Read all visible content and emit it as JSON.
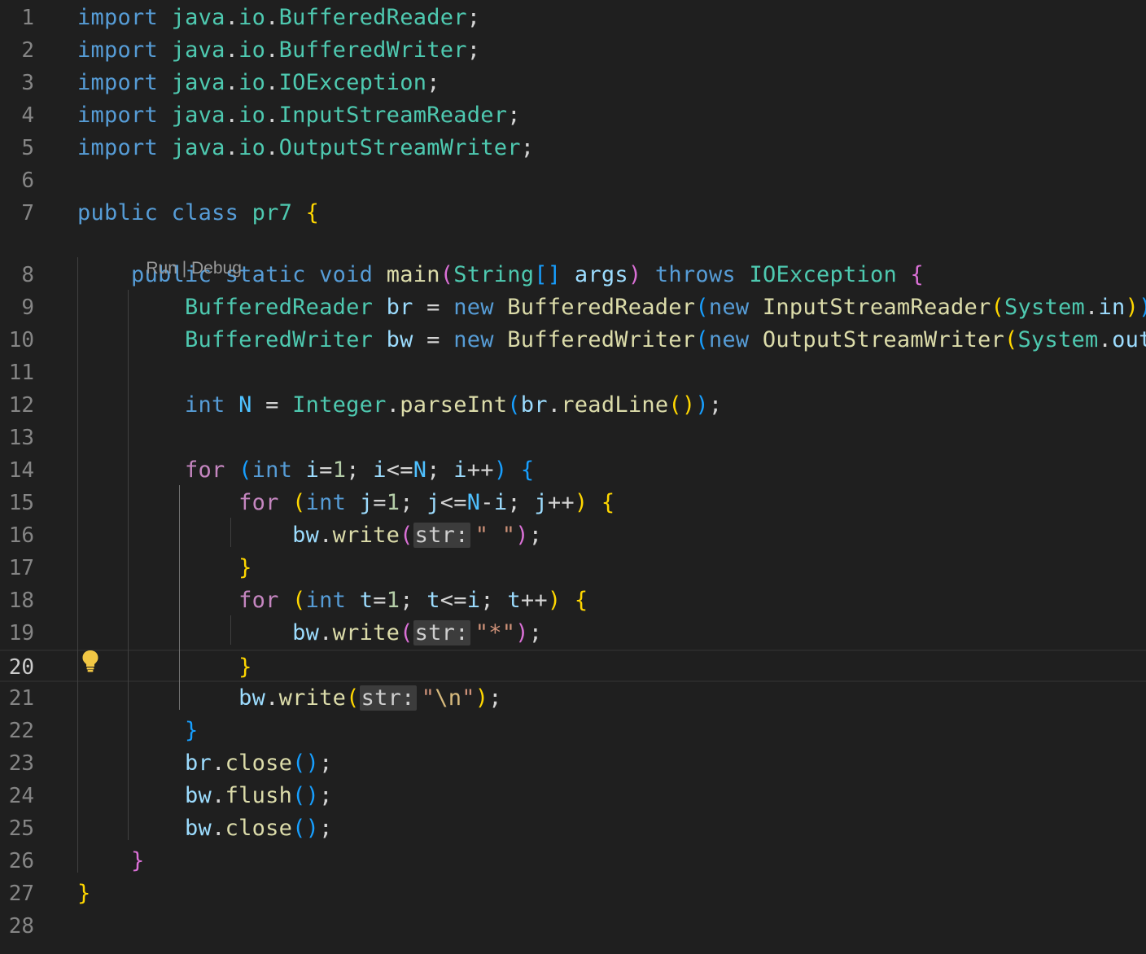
{
  "editor": {
    "code_lens": {
      "run": "Run",
      "separator": " | ",
      "debug": "Debug"
    },
    "current_line": 20,
    "lines": [
      {
        "n": "1",
        "tokens": [
          [
            "kw",
            "import"
          ],
          [
            "pun",
            " "
          ],
          [
            "pkg",
            "java"
          ],
          [
            "pun",
            "."
          ],
          [
            "pkg",
            "io"
          ],
          [
            "pun",
            "."
          ],
          [
            "typ",
            "BufferedReader"
          ],
          [
            "pun",
            ";"
          ]
        ]
      },
      {
        "n": "2",
        "tokens": [
          [
            "kw",
            "import"
          ],
          [
            "pun",
            " "
          ],
          [
            "pkg",
            "java"
          ],
          [
            "pun",
            "."
          ],
          [
            "pkg",
            "io"
          ],
          [
            "pun",
            "."
          ],
          [
            "typ",
            "BufferedWriter"
          ],
          [
            "pun",
            ";"
          ]
        ]
      },
      {
        "n": "3",
        "tokens": [
          [
            "kw",
            "import"
          ],
          [
            "pun",
            " "
          ],
          [
            "pkg",
            "java"
          ],
          [
            "pun",
            "."
          ],
          [
            "pkg",
            "io"
          ],
          [
            "pun",
            "."
          ],
          [
            "typ",
            "IOException"
          ],
          [
            "pun",
            ";"
          ]
        ]
      },
      {
        "n": "4",
        "tokens": [
          [
            "kw",
            "import"
          ],
          [
            "pun",
            " "
          ],
          [
            "pkg",
            "java"
          ],
          [
            "pun",
            "."
          ],
          [
            "pkg",
            "io"
          ],
          [
            "pun",
            "."
          ],
          [
            "typ",
            "InputStreamReader"
          ],
          [
            "pun",
            ";"
          ]
        ]
      },
      {
        "n": "5",
        "tokens": [
          [
            "kw",
            "import"
          ],
          [
            "pun",
            " "
          ],
          [
            "pkg",
            "java"
          ],
          [
            "pun",
            "."
          ],
          [
            "pkg",
            "io"
          ],
          [
            "pun",
            "."
          ],
          [
            "typ",
            "OutputStreamWriter"
          ],
          [
            "pun",
            ";"
          ]
        ]
      },
      {
        "n": "6",
        "tokens": []
      },
      {
        "n": "7",
        "tokens": [
          [
            "kw",
            "public"
          ],
          [
            "pun",
            " "
          ],
          [
            "kw",
            "class"
          ],
          [
            "pun",
            " "
          ],
          [
            "typ",
            "pr7"
          ],
          [
            "pun",
            " "
          ],
          [
            "b1",
            "{"
          ]
        ]
      },
      {
        "n": "8",
        "tokens": [
          [
            "pun",
            "    "
          ],
          [
            "kw",
            "public"
          ],
          [
            "pun",
            " "
          ],
          [
            "kw",
            "static"
          ],
          [
            "pun",
            " "
          ],
          [
            "kw",
            "void"
          ],
          [
            "pun",
            " "
          ],
          [
            "fn",
            "main"
          ],
          [
            "b2",
            "("
          ],
          [
            "typ",
            "String"
          ],
          [
            "b3",
            "[]"
          ],
          [
            "pun",
            " "
          ],
          [
            "var",
            "args"
          ],
          [
            "b2",
            ")"
          ],
          [
            "pun",
            " "
          ],
          [
            "kw",
            "throws"
          ],
          [
            "pun",
            " "
          ],
          [
            "typ",
            "IOException"
          ],
          [
            "pun",
            " "
          ],
          [
            "b2",
            "{"
          ]
        ]
      },
      {
        "n": "9",
        "tokens": [
          [
            "pun",
            "        "
          ],
          [
            "typ",
            "BufferedReader"
          ],
          [
            "pun",
            " "
          ],
          [
            "var",
            "br"
          ],
          [
            "pun",
            " = "
          ],
          [
            "kw",
            "new"
          ],
          [
            "pun",
            " "
          ],
          [
            "fn",
            "BufferedReader"
          ],
          [
            "b3",
            "("
          ],
          [
            "kw",
            "new"
          ],
          [
            "pun",
            " "
          ],
          [
            "fn",
            "InputStreamReader"
          ],
          [
            "b1",
            "("
          ],
          [
            "typ",
            "System"
          ],
          [
            "pun",
            "."
          ],
          [
            "var",
            "in"
          ],
          [
            "b1",
            ")"
          ],
          [
            "b3",
            ")"
          ],
          [
            "pun",
            ";"
          ]
        ]
      },
      {
        "n": "10",
        "tokens": [
          [
            "pun",
            "        "
          ],
          [
            "typ",
            "BufferedWriter"
          ],
          [
            "pun",
            " "
          ],
          [
            "var",
            "bw"
          ],
          [
            "pun",
            " = "
          ],
          [
            "kw",
            "new"
          ],
          [
            "pun",
            " "
          ],
          [
            "fn",
            "BufferedWriter"
          ],
          [
            "b3",
            "("
          ],
          [
            "kw",
            "new"
          ],
          [
            "pun",
            " "
          ],
          [
            "fn",
            "OutputStreamWriter"
          ],
          [
            "b1",
            "("
          ],
          [
            "typ",
            "System"
          ],
          [
            "pun",
            "."
          ],
          [
            "var",
            "out"
          ],
          [
            "b1",
            ")"
          ],
          [
            "b3",
            ")"
          ],
          [
            "pun",
            ";"
          ]
        ]
      },
      {
        "n": "11",
        "tokens": []
      },
      {
        "n": "12",
        "tokens": [
          [
            "pun",
            "        "
          ],
          [
            "kw",
            "int"
          ],
          [
            "pun",
            " "
          ],
          [
            "cst",
            "N"
          ],
          [
            "pun",
            " = "
          ],
          [
            "typ",
            "Integer"
          ],
          [
            "pun",
            "."
          ],
          [
            "fn",
            "parseInt"
          ],
          [
            "b3",
            "("
          ],
          [
            "var",
            "br"
          ],
          [
            "pun",
            "."
          ],
          [
            "fn",
            "readLine"
          ],
          [
            "b1",
            "()"
          ],
          [
            "b3",
            ")"
          ],
          [
            "pun",
            ";"
          ]
        ]
      },
      {
        "n": "13",
        "tokens": []
      },
      {
        "n": "14",
        "tokens": [
          [
            "pun",
            "        "
          ],
          [
            "ctl",
            "for"
          ],
          [
            "pun",
            " "
          ],
          [
            "b3",
            "("
          ],
          [
            "kw",
            "int"
          ],
          [
            "pun",
            " "
          ],
          [
            "var",
            "i"
          ],
          [
            "pun",
            "="
          ],
          [
            "num",
            "1"
          ],
          [
            "pun",
            "; "
          ],
          [
            "var",
            "i"
          ],
          [
            "pun",
            "<="
          ],
          [
            "cst",
            "N"
          ],
          [
            "pun",
            "; "
          ],
          [
            "var",
            "i"
          ],
          [
            "pun",
            "++"
          ],
          [
            "b3",
            ")"
          ],
          [
            "pun",
            " "
          ],
          [
            "b3",
            "{"
          ]
        ]
      },
      {
        "n": "15",
        "tokens": [
          [
            "pun",
            "            "
          ],
          [
            "ctl",
            "for"
          ],
          [
            "pun",
            " "
          ],
          [
            "b1",
            "("
          ],
          [
            "kw",
            "int"
          ],
          [
            "pun",
            " "
          ],
          [
            "var",
            "j"
          ],
          [
            "pun",
            "="
          ],
          [
            "num",
            "1"
          ],
          [
            "pun",
            "; "
          ],
          [
            "var",
            "j"
          ],
          [
            "pun",
            "<="
          ],
          [
            "cst",
            "N"
          ],
          [
            "pun",
            "-"
          ],
          [
            "var",
            "i"
          ],
          [
            "pun",
            "; "
          ],
          [
            "var",
            "j"
          ],
          [
            "pun",
            "++"
          ],
          [
            "b1",
            ")"
          ],
          [
            "pun",
            " "
          ],
          [
            "b1",
            "{"
          ]
        ]
      },
      {
        "n": "16",
        "tokens": [
          [
            "pun",
            "                "
          ],
          [
            "var",
            "bw"
          ],
          [
            "pun",
            "."
          ],
          [
            "fn",
            "write"
          ],
          [
            "b2",
            "("
          ],
          [
            "hint",
            "str:"
          ],
          [
            "str",
            "\" \""
          ],
          [
            "b2",
            ")"
          ],
          [
            "pun",
            ";"
          ]
        ]
      },
      {
        "n": "17",
        "tokens": [
          [
            "pun",
            "            "
          ],
          [
            "b1",
            "}"
          ]
        ]
      },
      {
        "n": "18",
        "tokens": [
          [
            "pun",
            "            "
          ],
          [
            "ctl",
            "for"
          ],
          [
            "pun",
            " "
          ],
          [
            "b1",
            "("
          ],
          [
            "kw",
            "int"
          ],
          [
            "pun",
            " "
          ],
          [
            "var",
            "t"
          ],
          [
            "pun",
            "="
          ],
          [
            "num",
            "1"
          ],
          [
            "pun",
            "; "
          ],
          [
            "var",
            "t"
          ],
          [
            "pun",
            "<="
          ],
          [
            "var",
            "i"
          ],
          [
            "pun",
            "; "
          ],
          [
            "var",
            "t"
          ],
          [
            "pun",
            "++"
          ],
          [
            "b1",
            ")"
          ],
          [
            "pun",
            " "
          ],
          [
            "b1",
            "{"
          ]
        ]
      },
      {
        "n": "19",
        "tokens": [
          [
            "pun",
            "                "
          ],
          [
            "var",
            "bw"
          ],
          [
            "pun",
            "."
          ],
          [
            "fn",
            "write"
          ],
          [
            "b2",
            "("
          ],
          [
            "hint",
            "str:"
          ],
          [
            "str",
            "\"*\""
          ],
          [
            "b2",
            ")"
          ],
          [
            "pun",
            ";"
          ]
        ]
      },
      {
        "n": "20",
        "tokens": [
          [
            "pun",
            "            "
          ],
          [
            "b1",
            "}"
          ]
        ]
      },
      {
        "n": "21",
        "tokens": [
          [
            "pun",
            "            "
          ],
          [
            "var",
            "bw"
          ],
          [
            "pun",
            "."
          ],
          [
            "fn",
            "write"
          ],
          [
            "b1",
            "("
          ],
          [
            "hint",
            "str:"
          ],
          [
            "str",
            "\""
          ],
          [
            "esc",
            "\\n"
          ],
          [
            "str",
            "\""
          ],
          [
            "b1",
            ")"
          ],
          [
            "pun",
            ";"
          ]
        ]
      },
      {
        "n": "22",
        "tokens": [
          [
            "pun",
            "        "
          ],
          [
            "b3",
            "}"
          ]
        ]
      },
      {
        "n": "23",
        "tokens": [
          [
            "pun",
            "        "
          ],
          [
            "var",
            "br"
          ],
          [
            "pun",
            "."
          ],
          [
            "fn",
            "close"
          ],
          [
            "b3",
            "()"
          ],
          [
            "pun",
            ";"
          ]
        ]
      },
      {
        "n": "24",
        "tokens": [
          [
            "pun",
            "        "
          ],
          [
            "var",
            "bw"
          ],
          [
            "pun",
            "."
          ],
          [
            "fn",
            "flush"
          ],
          [
            "b3",
            "()"
          ],
          [
            "pun",
            ";"
          ]
        ]
      },
      {
        "n": "25",
        "tokens": [
          [
            "pun",
            "        "
          ],
          [
            "var",
            "bw"
          ],
          [
            "pun",
            "."
          ],
          [
            "fn",
            "close"
          ],
          [
            "b3",
            "()"
          ],
          [
            "pun",
            ";"
          ]
        ]
      },
      {
        "n": "26",
        "tokens": [
          [
            "pun",
            "    "
          ],
          [
            "b2",
            "}"
          ]
        ]
      },
      {
        "n": "27",
        "tokens": [
          [
            "b1",
            "}"
          ]
        ]
      },
      {
        "n": "28",
        "tokens": []
      }
    ]
  }
}
